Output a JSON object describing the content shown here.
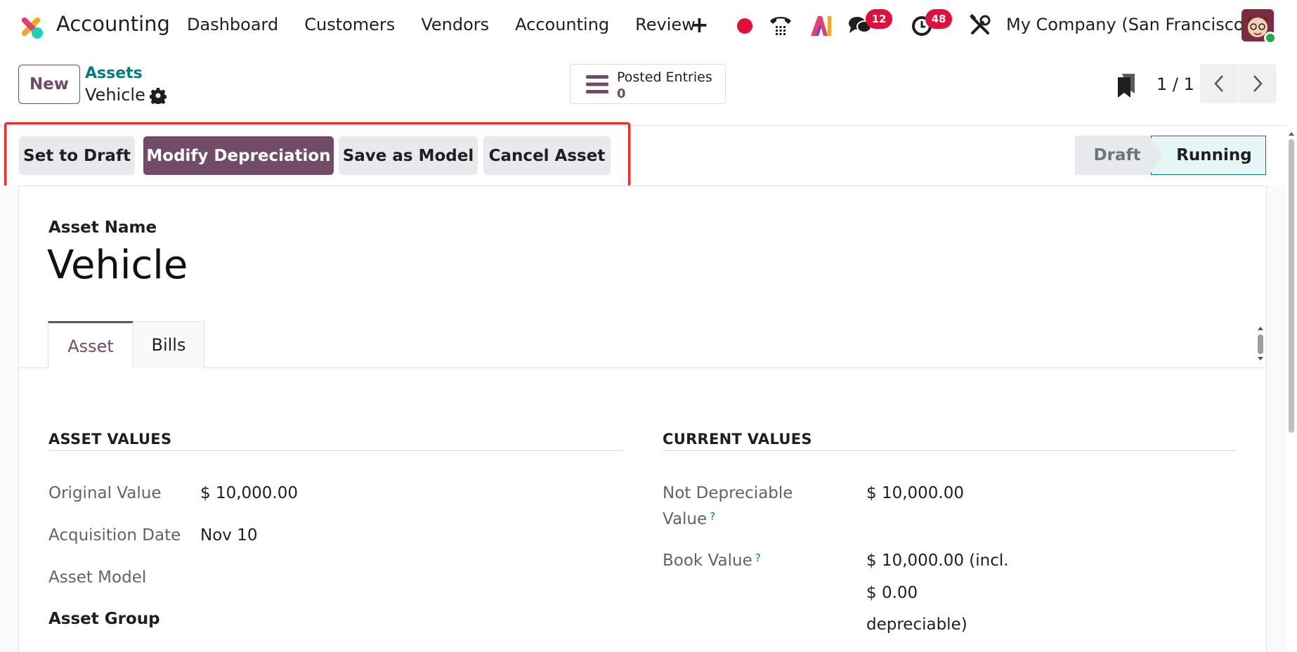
{
  "navbar": {
    "app_name": "Accounting",
    "menu": [
      "Dashboard",
      "Customers",
      "Vendors",
      "Accounting",
      "Review"
    ],
    "plus": "+",
    "chat_badge": "12",
    "activity_badge": "48",
    "company": "My Company (San Francisco)"
  },
  "control_panel": {
    "new_label": "New",
    "breadcrumb_parent": "Assets",
    "breadcrumb_current": "Vehicle",
    "smart_button": {
      "label": "Posted Entries",
      "value": "0"
    },
    "pager": "1 / 1"
  },
  "statusbar": {
    "buttons": {
      "set_to_draft": "Set to Draft",
      "modify_depreciation": "Modify Depreciation",
      "save_as_model": "Save as Model",
      "cancel_asset": "Cancel Asset"
    },
    "stages": [
      "Draft",
      "Running"
    ],
    "current_stage": "Running"
  },
  "form": {
    "asset_name_label": "Asset Name",
    "asset_name": "Vehicle",
    "tabs": [
      "Asset",
      "Bills"
    ],
    "asset_values": {
      "title": "ASSET VALUES",
      "original_value_label": "Original Value",
      "original_value": "$ 10,000.00",
      "acquisition_date_label": "Acquisition Date",
      "acquisition_date": "Nov 10",
      "asset_model_label": "Asset Model",
      "asset_group_label": "Asset Group"
    },
    "current_values": {
      "title": "CURRENT VALUES",
      "not_depreciable_label_1": "Not Depreciable",
      "not_depreciable_label_2": "Value",
      "not_depreciable_value": "$ 10,000.00",
      "book_value_label": "Book Value",
      "book_value_line1": "$ 10,000.00 (incl.",
      "book_value_line2": "$ 0.00",
      "book_value_line3": "depreciable)",
      "help_mark": "?"
    }
  },
  "colors": {
    "brand": "#714b67",
    "teal": "#017e84",
    "badge": "#e0103a",
    "highlight": "#ff2020"
  }
}
